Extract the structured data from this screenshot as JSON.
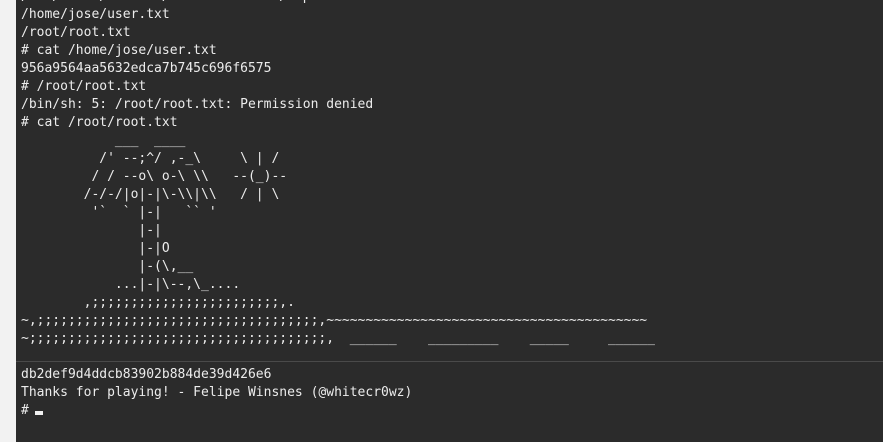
{
  "terminal": {
    "upper_lines": [
      "/var/cache/debconf/debconf-common/depot-directories.txt",
      "/home/jose/user.txt",
      "/root/root.txt",
      "# cat /home/jose/user.txt",
      "956a9564aa5632edca7b745c696f6575",
      "# /root/root.txt",
      "/bin/sh: 5: /root/root.txt: Permission denied",
      "# cat /root/root.txt",
      "            ___  ____",
      "          /' --;^/ ,-_\\     \\ | /",
      "         / / --o\\ o-\\ \\\\   --(_)--",
      "        /-/-/|o|-|\\-\\\\|\\\\   / | \\",
      "         '`  ` |-|   `` '",
      "               |-|",
      "               |-|O",
      "               |-(\\,__",
      "            ...|-|\\--,\\_....",
      "        ,;;;;;;;;;;;;;;;;;;;;;;;;,.",
      "~,;;;;;;;;;;;;;;;;;;;;;;;;;;;;;;;;;;;;,~~~~~~~~~~~~~~~~~~~~~~~~~~~~~~~~~~~~~~~~~",
      "~;;;;;;;;;;;;;;;;;;;;;;;;;;;;;;;;;;;;;;,  ______    _________    _____     ______"
    ],
    "lower_lines": [
      "db2def9d4ddcb83902b884de39d426e6",
      "",
      "Thanks for playing! - Felipe Winsnes (@whitecr0wz)",
      "#"
    ]
  }
}
